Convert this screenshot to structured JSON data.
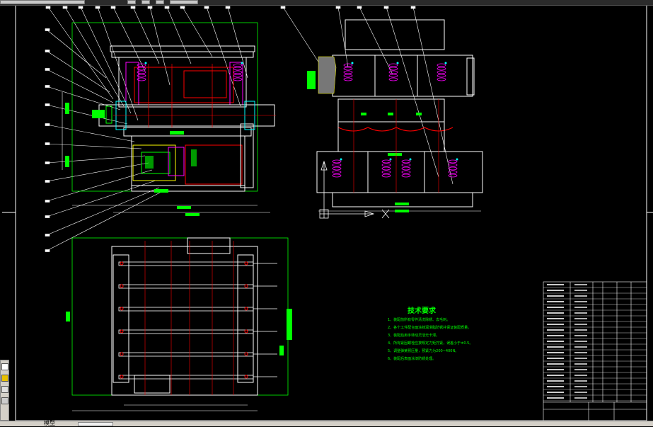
{
  "technical_requirements": {
    "title": "技术要求",
    "lines": [
      "1、装配前所有零件清洗除锈、去毛刺。",
      "2、各个工件配合面涂抹润滑脂防锈并保证装配质量。",
      "3、装配后用手转动灵活无卡滞。",
      "4、所有紧固螺栓应按规定力矩拧紧，误差小于±0.5。",
      "5、调整弹簧预压量，预紧力为200~400N。",
      "6、装配后表面涂漆防锈处理。"
    ]
  },
  "colors": {
    "background": "#000000",
    "outline": "#ffffff",
    "centerline": "#ff0000",
    "dimension": "#00ff00",
    "spring": "#ff00ff",
    "bolt": "#00ffff",
    "hatch": "#ffff00"
  },
  "icons": {
    "ucs": "ucs-icon",
    "spring": "spring-icon",
    "bolt": "bolt-icon"
  },
  "status": {
    "text": "模型",
    "ucs_x": "X",
    "ucs_y": "Y"
  }
}
